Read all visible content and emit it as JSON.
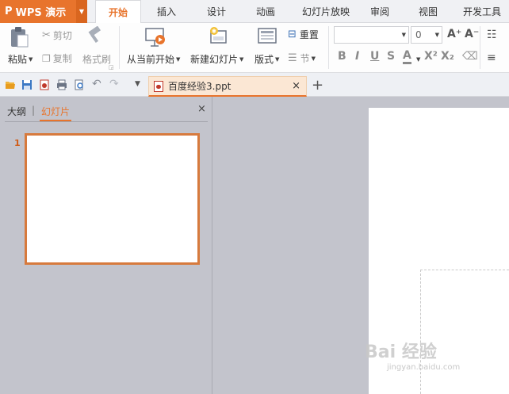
{
  "app": {
    "name": "WPS 演示",
    "logo": "P"
  },
  "menu": [
    "开始",
    "插入",
    "设计",
    "动画",
    "幻灯片放映",
    "审阅",
    "视图",
    "开发工具"
  ],
  "ribbon": {
    "paste": "粘贴",
    "cut": "剪切",
    "copy": "复制",
    "format_painter": "格式刷",
    "from_current": "从当前开始",
    "new_slide": "新建幻灯片",
    "layout": "版式",
    "reset": "重置",
    "section": "节",
    "font_size": "0",
    "grow": "A⁺",
    "shrink": "A⁻",
    "bold": "B",
    "italic": "I",
    "underline": "U",
    "strike": "S",
    "color": "A",
    "sup": "X²",
    "sub": "X₂"
  },
  "document": {
    "tab_name": "百度经验3.ppt",
    "close": "×",
    "new": "+"
  },
  "left_panel": {
    "tab_outline": "大纲",
    "divider": "|",
    "tab_slides": "幻灯片",
    "close": "×",
    "slide_number": "1"
  },
  "watermark": {
    "text": "Bai 经验",
    "sub": "jingyan.baidu.com"
  },
  "colors": {
    "accent": "#e8742c",
    "panel": "#c3c4cc"
  }
}
